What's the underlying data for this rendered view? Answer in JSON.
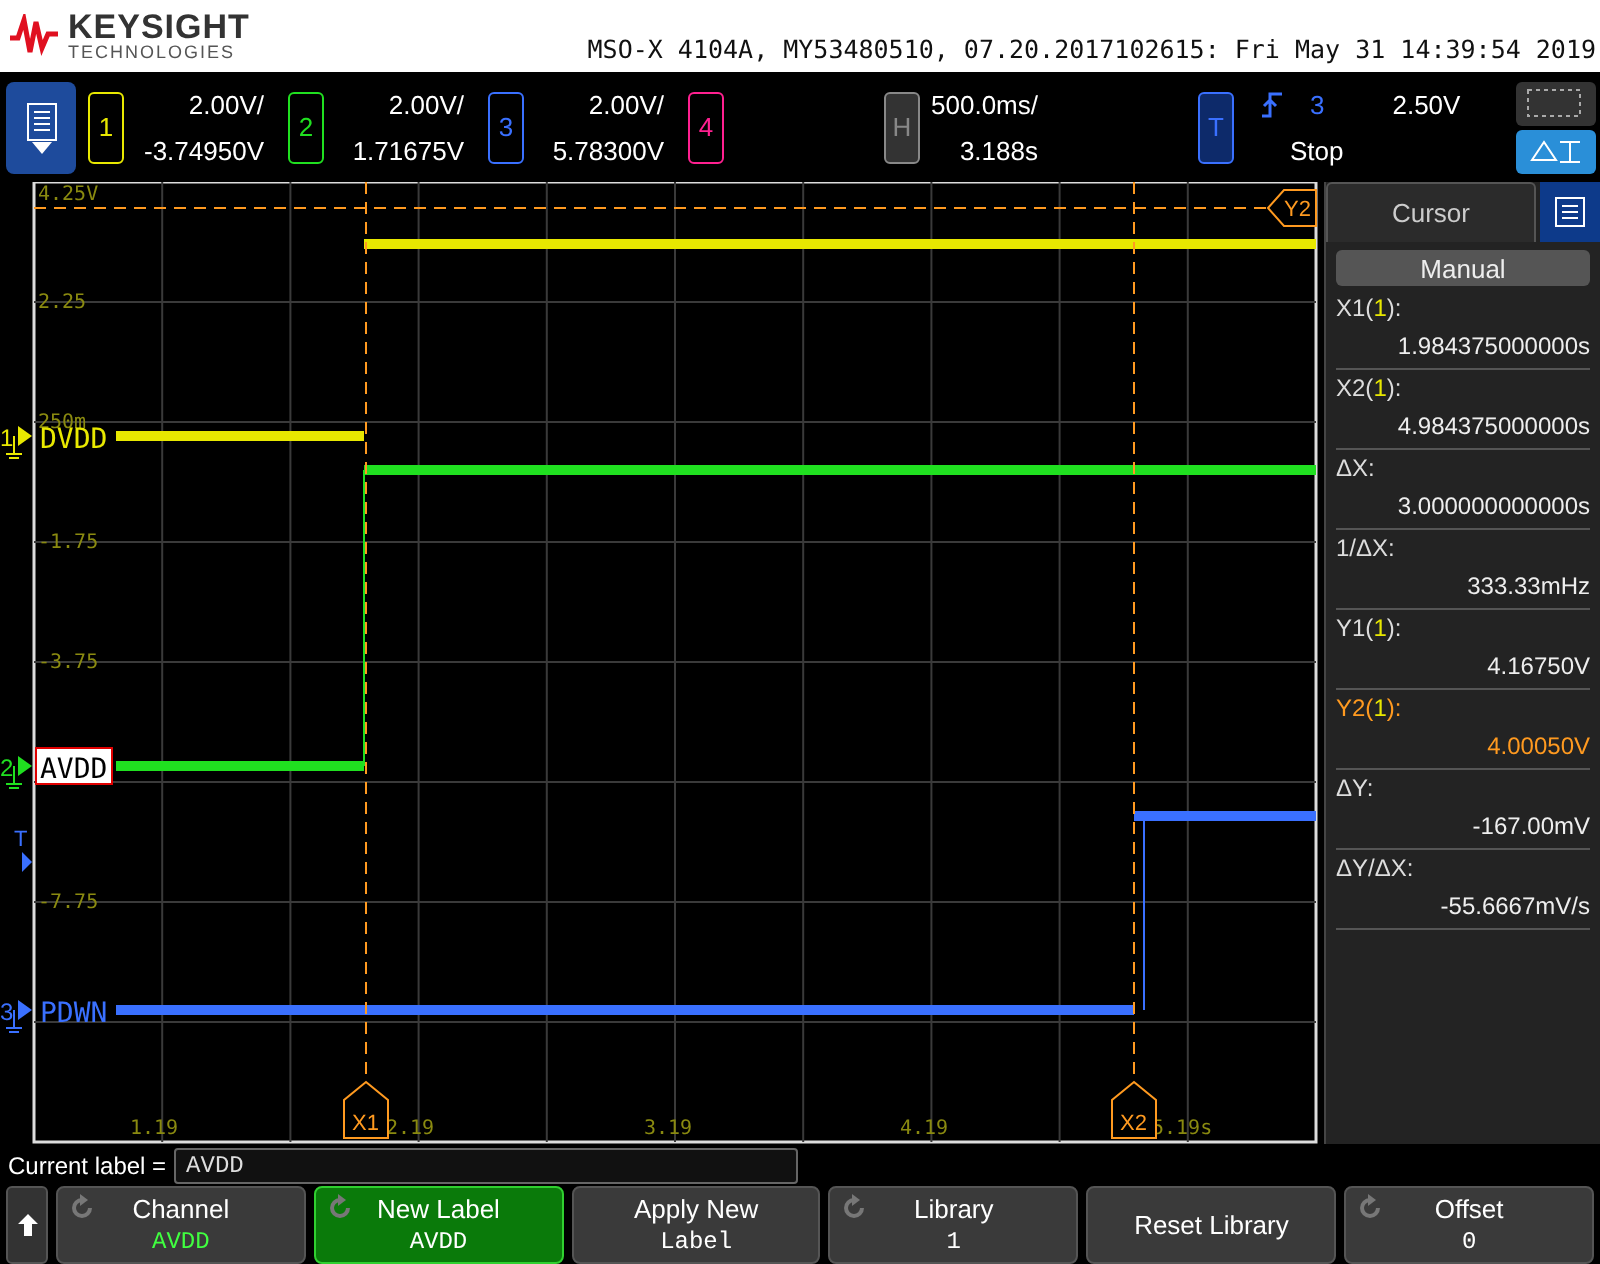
{
  "header": {
    "brand": "KEYSIGHT",
    "sub": "TECHNOLOGIES",
    "info": "MSO-X 4104A, MY53480510, 07.20.2017102615: Fri May 31 14:39:54 2019"
  },
  "channels": [
    {
      "number": "1",
      "scale": "2.00V/",
      "offset": "-3.74950V",
      "color": "#e8e800"
    },
    {
      "number": "2",
      "scale": "2.00V/",
      "offset": "1.71675V",
      "color": "#20e020"
    },
    {
      "number": "3",
      "scale": "2.00V/",
      "offset": "5.78300V",
      "color": "#3a70ff"
    },
    {
      "number": "4",
      "color": "#ff2090"
    }
  ],
  "horizontal": {
    "label": "H",
    "scale": "500.0ms/",
    "delay": "3.188s"
  },
  "trigger": {
    "label": "T",
    "source": "3",
    "level": "2.50V",
    "state": "Stop"
  },
  "plot": {
    "y_labels": [
      "4.25V",
      "2.25",
      "250m",
      "-1.75",
      "-3.75",
      "-7.75"
    ],
    "x_labels": [
      "1.19",
      "2.19",
      "3.19",
      "4.19",
      "5.19s"
    ],
    "traces": [
      {
        "marker": "1",
        "label": "DVDD",
        "color": "#e8e800",
        "selected": false
      },
      {
        "marker": "2",
        "label": "AVDD",
        "color": "#20e020",
        "selected": true
      },
      {
        "marker": "3",
        "label": "PDWN",
        "color": "#3a70ff",
        "selected": false
      }
    ],
    "trigger_marker": "T",
    "cursors": [
      {
        "label": "X1",
        "kind": "x"
      },
      {
        "label": "X2",
        "kind": "x"
      },
      {
        "label": "Y2",
        "kind": "y"
      }
    ]
  },
  "cursor_panel": {
    "title": "Cursor",
    "mode": "Manual",
    "readings": [
      {
        "prefix": "X1(",
        "source": "1",
        "suffix": "):",
        "value": "1.984375000000s",
        "highlighted": false
      },
      {
        "prefix": "X2(",
        "source": "1",
        "suffix": "):",
        "value": "4.984375000000s",
        "highlighted": false
      },
      {
        "prefix": "ΔX:",
        "value": "3.000000000000s",
        "highlighted": false
      },
      {
        "prefix": "1/ΔX:",
        "value": "333.33mHz",
        "highlighted": false
      },
      {
        "prefix": "Y1(",
        "source": "1",
        "suffix": "):",
        "value": "4.16750V",
        "highlighted": false
      },
      {
        "prefix": "Y2(",
        "source": "1",
        "suffix": "):",
        "value": "4.00050V",
        "highlighted": true
      },
      {
        "prefix": "ΔY:",
        "value": "-167.00mV",
        "highlighted": false
      },
      {
        "prefix": "ΔY/ΔX:",
        "value": "-55.6667mV/s",
        "highlighted": false
      }
    ]
  },
  "label_bar": {
    "label": "Current label =",
    "value": "AVDD"
  },
  "softkeys": [
    {
      "title": "Channel",
      "value": "AVDD",
      "knob": true,
      "selected": false
    },
    {
      "title": "New Label",
      "value": "AVDD",
      "knob": true,
      "selected": true
    },
    {
      "title": "Apply New",
      "value": "Label",
      "knob": false,
      "selected": false
    },
    {
      "title": "Library",
      "value": "1",
      "knob": true,
      "selected": false
    },
    {
      "title": "Reset Library",
      "knob": false,
      "selected": false
    },
    {
      "title": "Offset",
      "value": "0",
      "knob": true,
      "selected": false
    }
  ]
}
